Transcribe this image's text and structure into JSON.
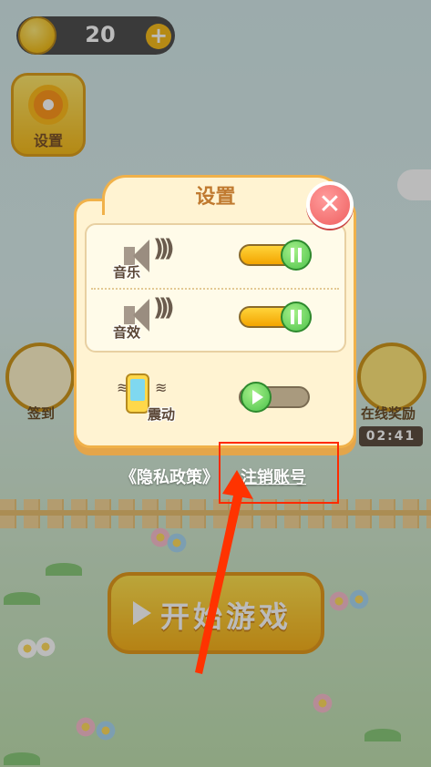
{
  "hud": {
    "coin_count": "20",
    "plus_label": "+",
    "settings_label": "设置"
  },
  "side": {
    "signin_label": "签到",
    "online_reward_label": "在线奖励",
    "online_timer": "02:41"
  },
  "start": {
    "label": "开始游戏"
  },
  "dialog": {
    "title": "设置",
    "close_label": "✕",
    "music": {
      "label": "音乐",
      "enabled": true
    },
    "sfx": {
      "label": "音效",
      "enabled": true
    },
    "vibrate": {
      "label": "震动",
      "enabled": false
    }
  },
  "links": {
    "privacy": "《隐私政策》",
    "cancel_account": "注销账号"
  },
  "colors": {
    "highlight": "#ff2a00",
    "accent": "#f0b14a",
    "toggle_on": "#f3a400",
    "knob": "#4cc24a"
  }
}
